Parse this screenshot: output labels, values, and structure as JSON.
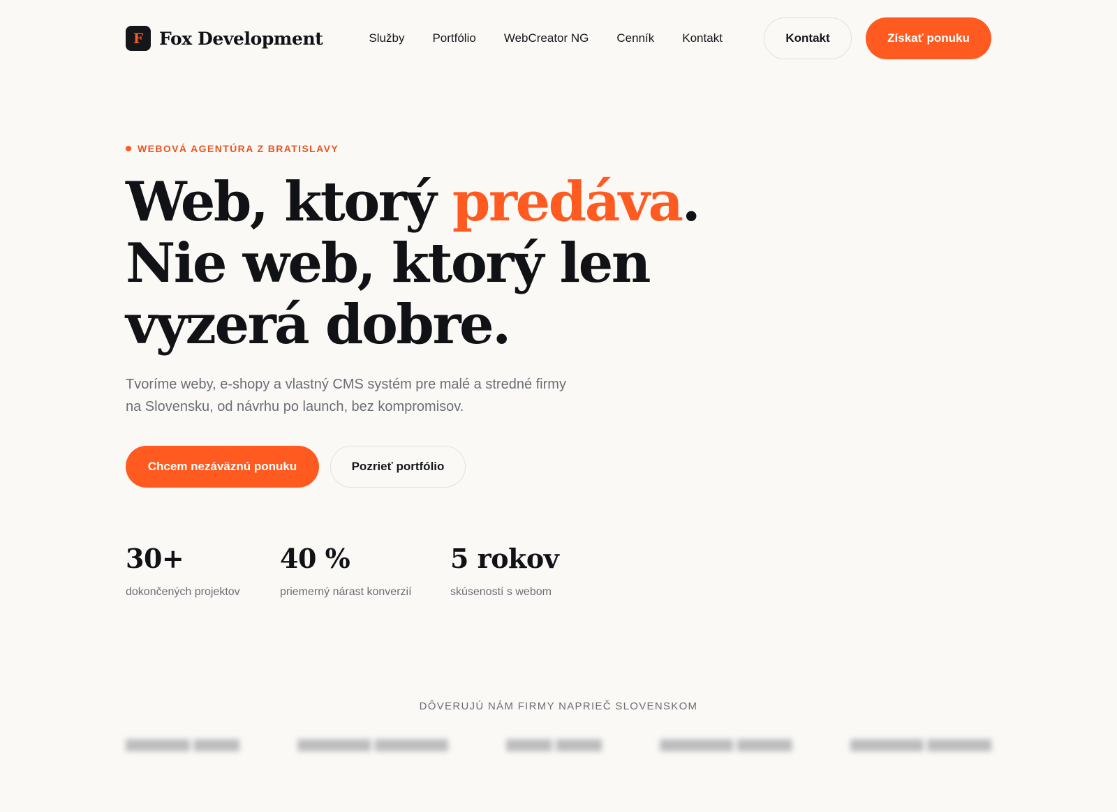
{
  "brand": {
    "mark": "F",
    "name": "Fox Development"
  },
  "nav": {
    "links": [
      "Služby",
      "Portfólio",
      "WebCreator NG",
      "Cenník",
      "Kontakt"
    ],
    "contact_button": "Kontakt",
    "cta_button": "Získať ponuku"
  },
  "hero": {
    "eyebrow": "WEBOVÁ AGENTÚRA Z BRATISLAVY",
    "headline_part1": "Web, ktorý ",
    "headline_accent": "predáva",
    "headline_part2": ".",
    "headline_line2": "Nie web, ktorý len",
    "headline_line3": "vyzerá dobre.",
    "lead": "Tvoríme weby, e-shopy a vlastný CMS systém pre malé a stredné firmy na Slovensku, od návrhu po launch, bez kompromisov.",
    "primary_button": "Chcem nezáväznú ponuku",
    "secondary_button": "Pozrieť portfólio"
  },
  "stats": [
    {
      "value": "30+",
      "label": "dokončených projektov"
    },
    {
      "value": "40 %",
      "label": "priemerný nárast konverzií"
    },
    {
      "value": "5 rokov",
      "label": "skúseností s webom"
    }
  ],
  "trust": {
    "title": "DÔVERUJÚ NÁM FIRMY NAPRIEČ SLOVENSKOM"
  },
  "colors": {
    "accent": "#ff5a1f",
    "background": "#faf9f6",
    "text": "#111216",
    "muted": "#6b6e76"
  },
  "icons": {
    "eyebrow_dot": "dot-icon",
    "brand_mark": "fox-logo-icon"
  }
}
